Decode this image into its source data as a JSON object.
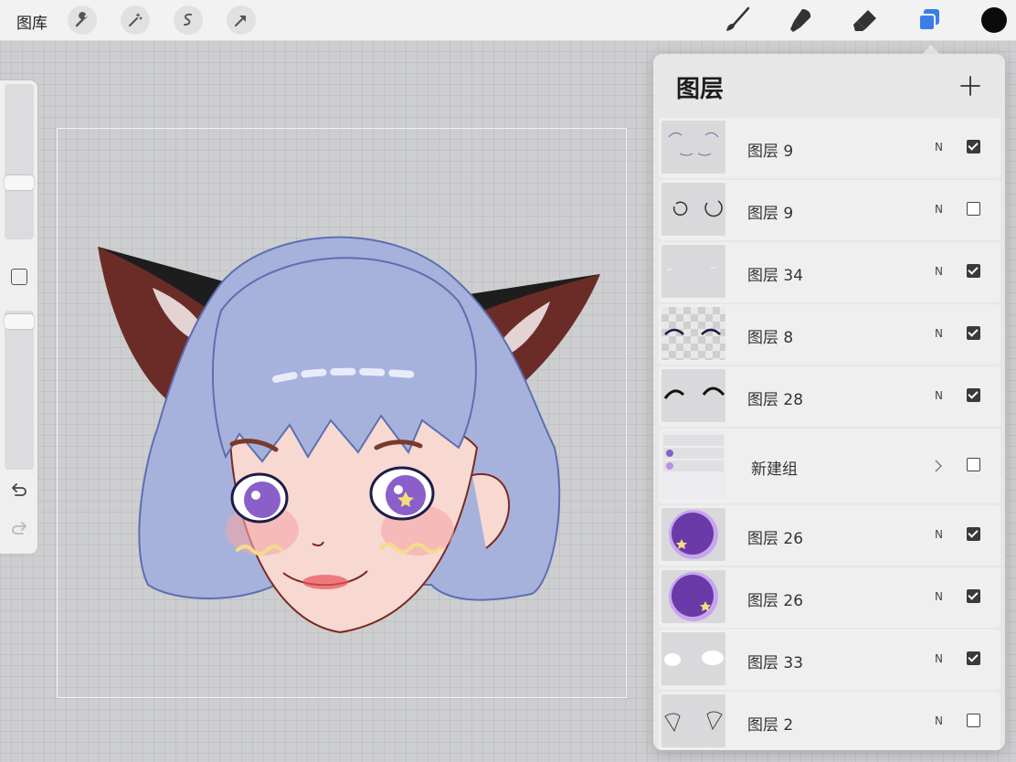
{
  "topbar": {
    "gallery_label": "图库",
    "left_tools": [
      "wrench-icon",
      "magic-wand-icon",
      "selection-icon",
      "transform-arrow-icon"
    ],
    "right_tools": [
      "brush-icon",
      "smudge-icon",
      "eraser-icon",
      "layers-icon"
    ],
    "accent_color": "#3b7fe6",
    "current_color": "#0b0b0b"
  },
  "sidebar": {
    "brush_size_level": 0.6,
    "opacity_level": 0.95
  },
  "layers_panel": {
    "title": "图层",
    "add_icon": "plus-icon",
    "layers": [
      {
        "name": "图层 9",
        "blend": "N",
        "visible": true
      },
      {
        "name": "图层 9",
        "blend": "N",
        "visible": false
      },
      {
        "name": "图层 34",
        "blend": "N",
        "visible": true
      },
      {
        "name": "图层 8",
        "blend": "N",
        "visible": true
      },
      {
        "name": "图层 28",
        "blend": "N",
        "visible": true
      },
      {
        "name": "新建组",
        "blend": "",
        "visible": false,
        "group": true
      },
      {
        "name": "图层 26",
        "blend": "N",
        "visible": true
      },
      {
        "name": "图层 26",
        "blend": "N",
        "visible": true
      },
      {
        "name": "图层 33",
        "blend": "N",
        "visible": true
      },
      {
        "name": "图层 2",
        "blend": "N",
        "visible": false
      }
    ]
  }
}
